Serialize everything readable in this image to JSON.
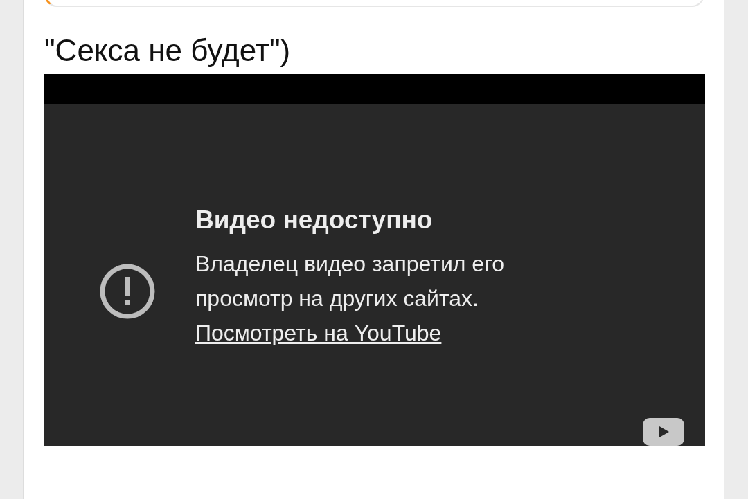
{
  "heading": "\"Секса не будет\")",
  "video": {
    "title": "Видео недоступно",
    "message": "Владелец видео запретил его просмотр на других сайтах.",
    "link": "Посмотреть на YouTube"
  }
}
